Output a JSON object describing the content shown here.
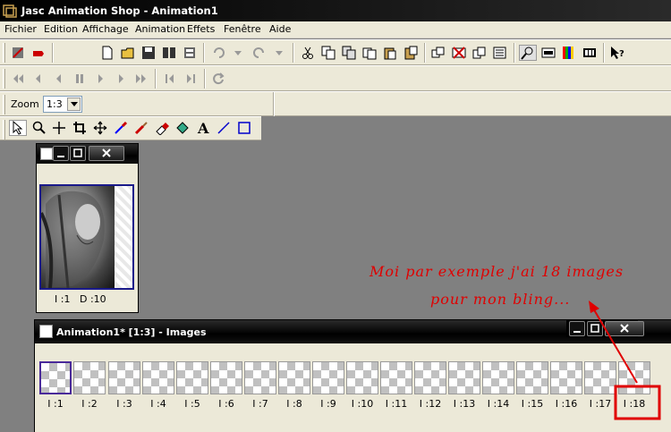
{
  "app": {
    "title": "Jasc Animation Shop - Animation1"
  },
  "menu": [
    "Fichier",
    "Edition",
    "Affichage",
    "Animation",
    "Effets",
    "Fenêtre",
    "Aide"
  ],
  "zoom": {
    "label": "Zoom :",
    "value": "1:3"
  },
  "preview_window": {
    "frame_label": "I :1",
    "delay_label": "D :10"
  },
  "images_window": {
    "title": "Animation1* [1:3] - Images",
    "frames": [
      "I :1",
      "I :2",
      "I :3",
      "I :4",
      "I :5",
      "I :6",
      "I :7",
      "I :8",
      "I :9",
      "I :10",
      "I :11",
      "I :12",
      "I :13",
      "I :14",
      "I :15",
      "I :16",
      "I :17",
      "I :18"
    ]
  },
  "annotation": {
    "line1": "Moi par exemple j'ai 18 images",
    "line2": "pour mon bling...",
    "color": "#e00000"
  },
  "icons": {
    "toolbar1": [
      "wizard-icon",
      "banner-icon",
      "new-icon",
      "open-icon",
      "save-icon",
      "save-frames-icon",
      "save-as-icon",
      "copy-print-icon",
      "undo-icon",
      "redo-icon",
      "cut-icon",
      "copy-icon",
      "copy-new-icon",
      "paste-icon",
      "insert-frames-icon",
      "delete-frames-icon",
      "duplicate-icon",
      "crop-icon",
      "zoom-icon",
      "view-frames-icon",
      "palette-icon",
      "film-icon",
      "help-icon"
    ],
    "toolbar2": [
      "first-frame-icon",
      "prev-frame-icon",
      "play-back-icon",
      "pause-icon",
      "play-icon",
      "next-frame-icon",
      "last-frame-icon",
      "prev-icon",
      "next-icon",
      "loop-icon"
    ],
    "toolbar4": [
      "arrow-tool-icon",
      "zoom-tool-icon",
      "crosshair-tool-icon",
      "crop-tool-icon",
      "move-tool-icon",
      "dropper-tool-icon",
      "brush-tool-icon",
      "eraser-tool-icon",
      "fill-tool-icon",
      "text-tool-icon",
      "line-tool-icon",
      "rectangle-tool-icon"
    ]
  }
}
